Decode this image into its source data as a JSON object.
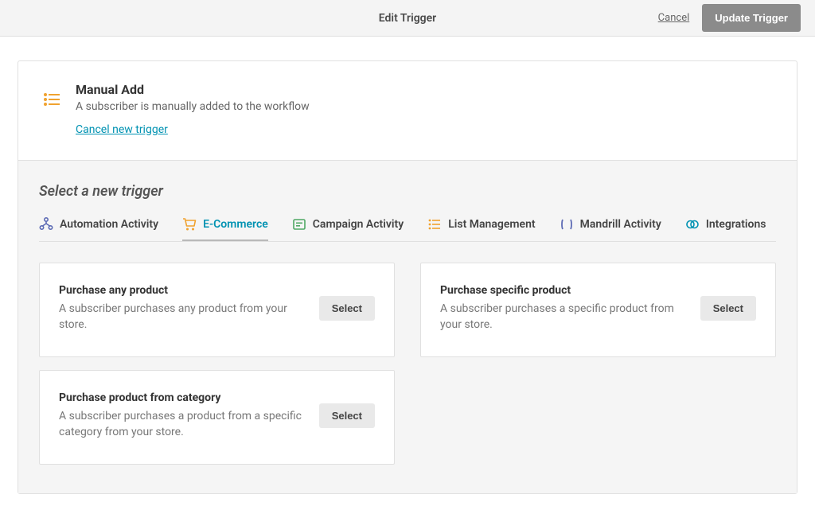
{
  "header": {
    "title": "Edit Trigger",
    "cancel": "Cancel",
    "update": "Update Trigger"
  },
  "currentTrigger": {
    "title": "Manual Add",
    "description": "A subscriber is manually added to the workflow",
    "cancelLink": "Cancel new trigger"
  },
  "selectSection": {
    "heading": "Select a new trigger"
  },
  "tabs": [
    {
      "label": "Automation Activity"
    },
    {
      "label": "E-Commerce"
    },
    {
      "label": "Campaign Activity"
    },
    {
      "label": "List Management"
    },
    {
      "label": "Mandrill Activity"
    },
    {
      "label": "Integrations"
    }
  ],
  "cards": [
    {
      "title": "Purchase any product",
      "description": "A subscriber purchases any product from your store.",
      "button": "Select"
    },
    {
      "title": "Purchase specific product",
      "description": "A subscriber purchases a specific product from your store.",
      "button": "Select"
    },
    {
      "title": "Purchase product from category",
      "description": "A subscriber purchases a product from a specific category from your store.",
      "button": "Select"
    }
  ]
}
